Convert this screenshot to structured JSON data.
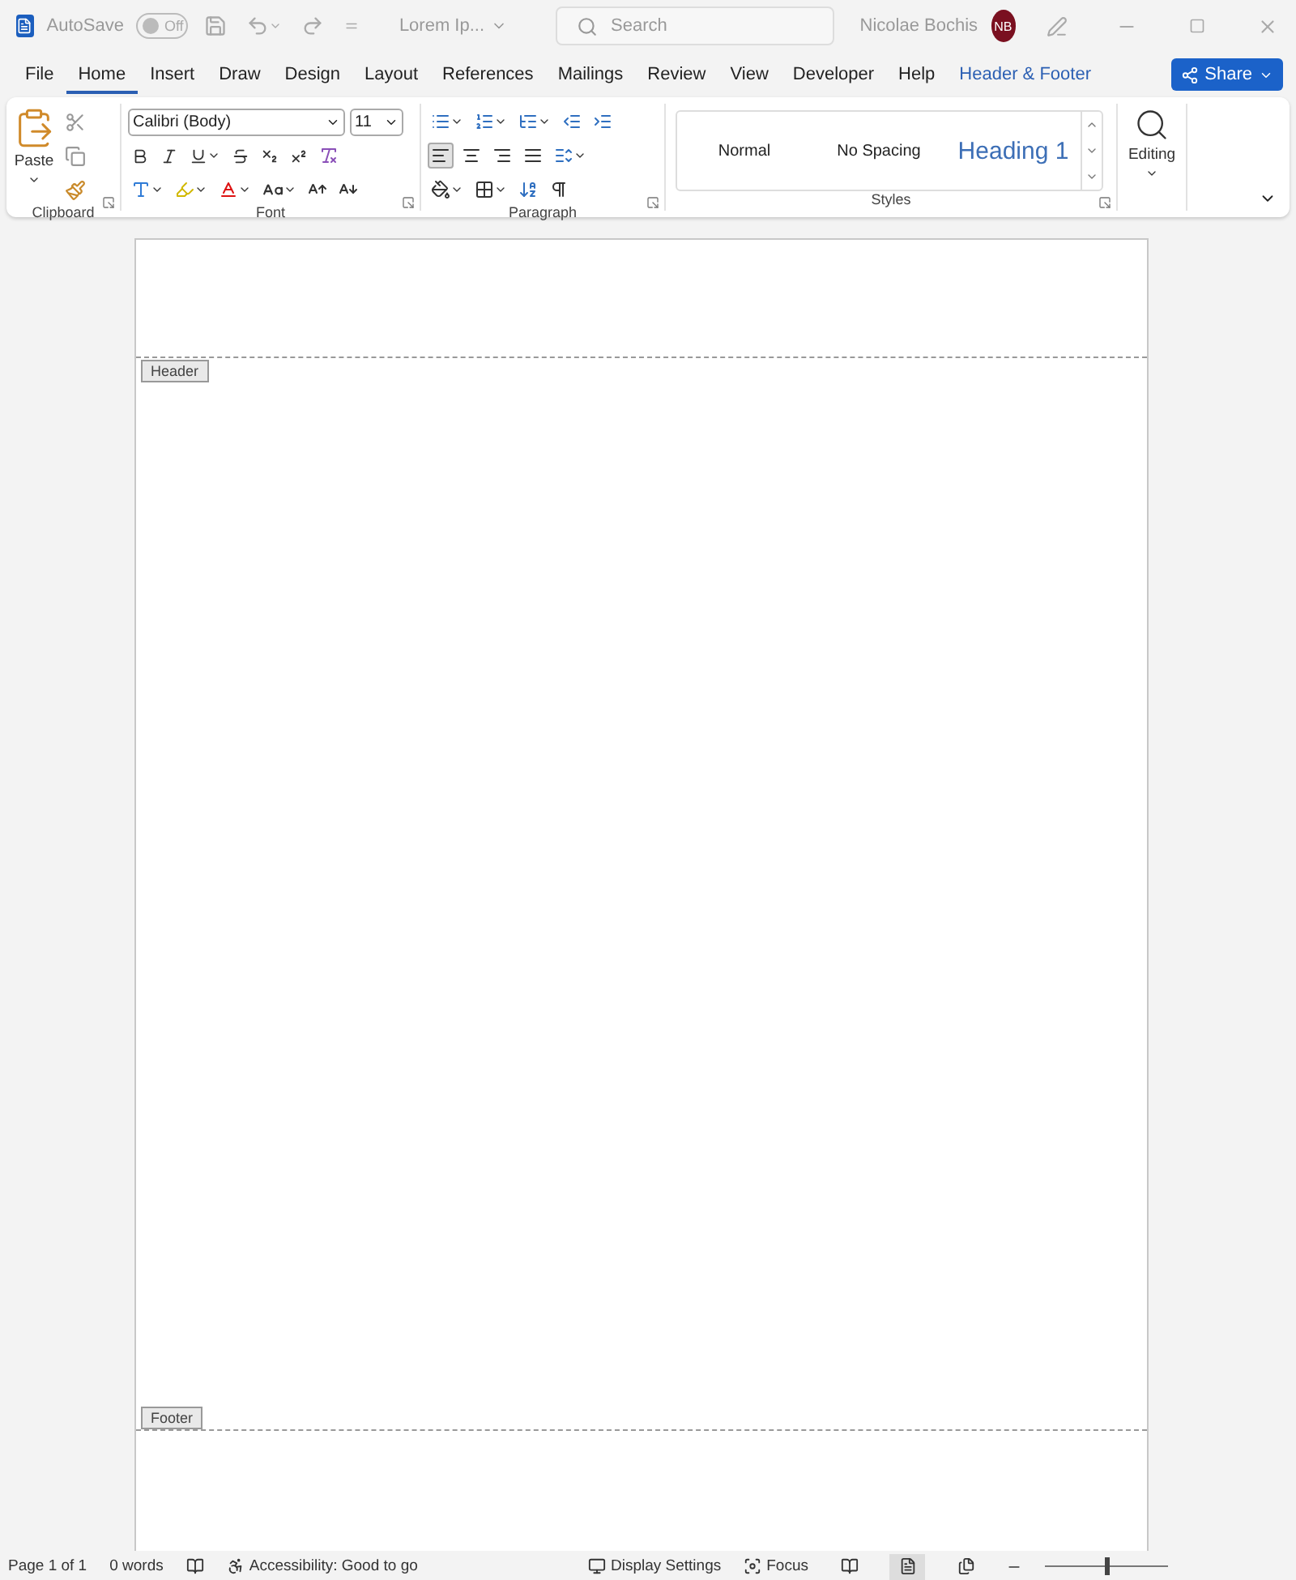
{
  "title_bar": {
    "autosave_label": "AutoSave",
    "autosave": {
      "on": false,
      "label": "Off"
    },
    "document_name": "Lorem Ip...",
    "search_placeholder": "Search",
    "user_name": "Nicolae Bochis",
    "avatar": "NB"
  },
  "tabs": [
    {
      "label": "File",
      "selected": false,
      "kind": "normal"
    },
    {
      "label": "Home",
      "selected": true,
      "kind": "normal"
    },
    {
      "label": "Insert",
      "selected": false,
      "kind": "normal"
    },
    {
      "label": "Draw",
      "selected": false,
      "kind": "normal"
    },
    {
      "label": "Design",
      "selected": false,
      "kind": "normal"
    },
    {
      "label": "Layout",
      "selected": false,
      "kind": "normal"
    },
    {
      "label": "References",
      "selected": false,
      "kind": "normal"
    },
    {
      "label": "Mailings",
      "selected": false,
      "kind": "normal"
    },
    {
      "label": "Review",
      "selected": false,
      "kind": "normal"
    },
    {
      "label": "View",
      "selected": false,
      "kind": "normal"
    },
    {
      "label": "Developer",
      "selected": false,
      "kind": "normal"
    },
    {
      "label": "Help",
      "selected": false,
      "kind": "normal"
    },
    {
      "label": "Header & Footer",
      "selected": false,
      "kind": "contextual"
    }
  ],
  "share_button": "Share",
  "ribbon": {
    "paste": "Paste",
    "clipboard_label": "Clipboard",
    "font_name": "Calibri (Body)",
    "font_size": "11",
    "font_label": "Font",
    "paragraph_label": "Paragraph",
    "styles": [
      "Normal",
      "No Spacing",
      "Heading 1"
    ],
    "styles_label": "Styles",
    "editing": "Editing"
  },
  "document": {
    "header_tag": "Header",
    "footer_tag": "Footer"
  },
  "status_bar": {
    "page": "Page 1 of 1",
    "words": "0 words",
    "accessibility": "Accessibility: Good to go",
    "display_settings": "Display Settings",
    "focus": "Focus",
    "zoom": {
      "level": 0.5
    }
  }
}
